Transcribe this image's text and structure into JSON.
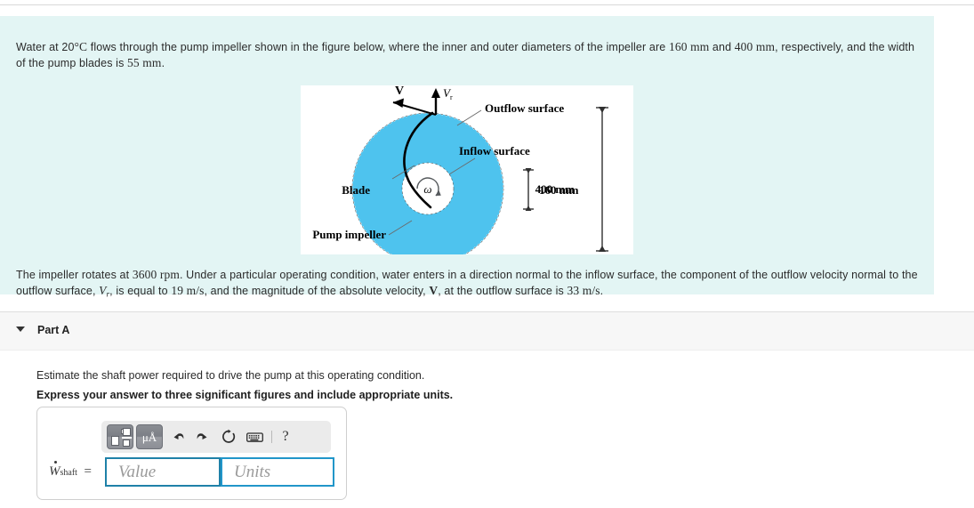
{
  "problem": {
    "intro_a": "Water at 20",
    "intro_deg": "°C",
    "intro_b": " flows through the pump impeller shown in the figure below, where the inner and outer diameters of the impeller are ",
    "inner_d": "160 mm",
    "intro_c": " and ",
    "outer_d": "400 mm",
    "intro_d": ", respectively, and the width of the pump blades is ",
    "blade_w": "55 mm",
    "intro_e": ".",
    "outro_a": "The impeller rotates at ",
    "rpm": "3600 rpm",
    "outro_b": ". Under a particular operating condition, water enters in a direction normal to the inflow surface, the component of the outflow velocity normal to the outflow surface, ",
    "vr_symbol": "V",
    "vr_sub": "r",
    "outro_c": ", is equal to ",
    "vr_value": "19 m/s",
    "outro_d": ", and the magnitude of the absolute velocity, ",
    "v_symbol": "V",
    "outro_e": ", at the outflow surface is ",
    "v_value": "33 m/s",
    "outro_f": "."
  },
  "figure": {
    "labels": {
      "v_vector": "V",
      "vr_vector": "V",
      "vr_vector_sub": "r",
      "outflow": "Outflow surface",
      "inflow": "Inflow surface",
      "blade": "Blade",
      "pump_impeller": "Pump impeller",
      "omega": "ω",
      "inner_dim": "160 mm",
      "outer_dim": "400 mm"
    },
    "colors": {
      "impeller_fill": "#4ec3ee",
      "outline": "#000000",
      "panel_bg": "#ffffff"
    }
  },
  "part": {
    "caret": "collapse-caret",
    "title": "Part A",
    "prompt": "Estimate the shaft power required to drive the pump at this operating condition.",
    "instruction": "Express your answer to three significant figures and include appropriate units."
  },
  "answer": {
    "label_symbol": "W",
    "label_sub": "shaft",
    "label_equals": "=",
    "value_placeholder": "Value",
    "units_placeholder": "Units",
    "value_current": "",
    "units_current": "",
    "toolbar": {
      "template_label": "template-picker",
      "units_label": "μÅ",
      "undo_label": "undo",
      "redo_label": "redo",
      "reset_label": "reset",
      "keyboard_label": "keyboard",
      "help_label": "?"
    }
  },
  "theme": {
    "panel_bg": "#e3f5f4",
    "band_bg": "#f7f7f7",
    "field_border": "#1f81a8",
    "field_border_active": "#2196c9"
  }
}
